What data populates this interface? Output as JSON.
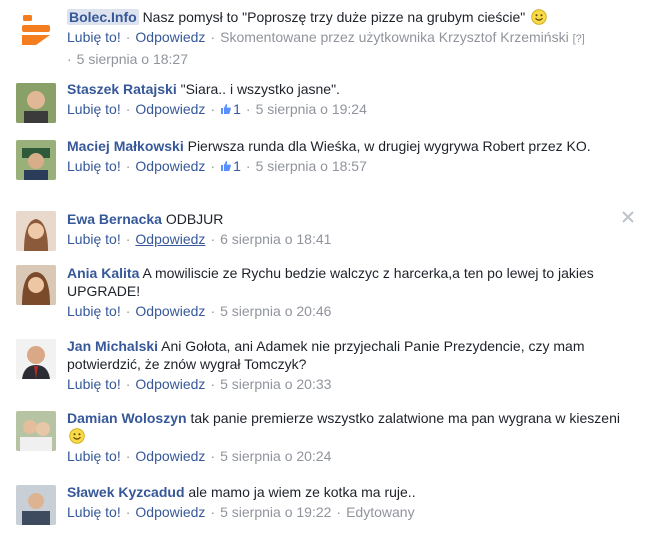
{
  "colors": {
    "link": "#365899",
    "meta": "#90949c",
    "text": "#1d2129"
  },
  "root": {
    "author": "Bolec.Info",
    "text": "Nasz pomysł to \"Poproszę trzy duże pizze na grubym cieście\"",
    "emoji": "smile-icon",
    "like": "Lubię to!",
    "reply": "Odpowiedz",
    "commented_by": "Skomentowane przez użytkownika Krzysztof Krzemiński",
    "help": "[?]",
    "time": "5 sierpnia o 18:27"
  },
  "comments": [
    {
      "author": "Staszek Ratajski",
      "text": "\"Siara.. i wszystko jasne\".",
      "like": "Lubię to!",
      "reply": "Odpowiedz",
      "likes": "1",
      "time": "5 sierpnia o 19:24"
    },
    {
      "author": "Maciej Małkowski",
      "text": "Pierwsza runda dla Wieśka, w drugiej wygrywa Robert przez KO.",
      "like": "Lubię to!",
      "reply": "Odpowiedz",
      "likes": "1",
      "time": "5 sierpnia o 18:57"
    },
    {
      "author": "Ewa Bernacka",
      "text": "ODBJUR",
      "like": "Lubię to!",
      "reply": "Odpowiedz",
      "time": "6 sierpnia o 18:41"
    },
    {
      "author": "Ania Kalita",
      "text": "A mowiliscie ze Rychu bedzie walczyc z harcerka,a ten po lewej to jakies UPGRADE!",
      "like": "Lubię to!",
      "reply": "Odpowiedz",
      "time": "5 sierpnia o 20:46"
    },
    {
      "author": "Jan Michalski",
      "text": "Ani Gołota, ani Adamek nie przyjechali Panie Prezydencie, czy mam potwierdzić, że znów wygrał Tomczyk?",
      "like": "Lubię to!",
      "reply": "Odpowiedz",
      "time": "5 sierpnia o 20:33"
    },
    {
      "author": "Damian Woloszyn",
      "text": "tak panie premierze wszystko zalatwione ma pan wygrana w kieszeni",
      "like": "Lubię to!",
      "reply": "Odpowiedz",
      "time": "5 sierpnia o 20:24"
    },
    {
      "author": "Sławek Kyzcadud",
      "text": "ale mamo ja wiem ze kotka ma ruje..",
      "like": "Lubię to!",
      "reply": "Odpowiedz",
      "time": "5 sierpnia o 19:22",
      "edited": "Edytowany"
    }
  ]
}
